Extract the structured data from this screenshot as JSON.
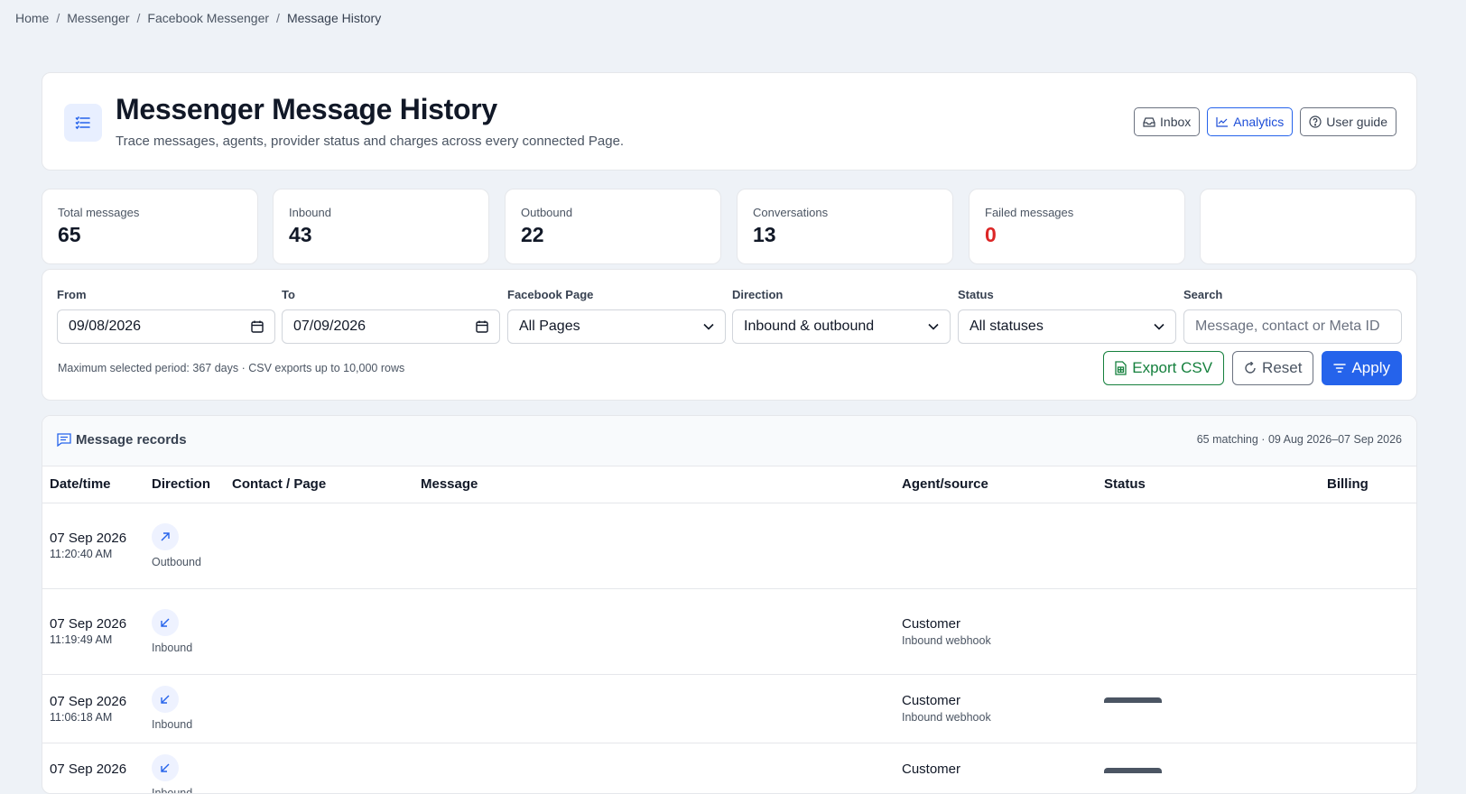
{
  "breadcrumb": [
    "Home",
    "Messenger",
    "Facebook Messenger",
    "Message History"
  ],
  "header": {
    "title": "Messenger Message History",
    "subtitle": "Trace messages, agents, provider status and charges across every connected Page.",
    "icon": "list-icon",
    "actions": {
      "inbox": "Inbox",
      "analytics": "Analytics",
      "guide": "User guide"
    }
  },
  "stats": [
    {
      "label": "Total messages",
      "value": "65"
    },
    {
      "label": "Inbound",
      "value": "43"
    },
    {
      "label": "Outbound",
      "value": "22"
    },
    {
      "label": "Conversations",
      "value": "13"
    },
    {
      "label": "Failed messages",
      "value": "0"
    }
  ],
  "filters": {
    "from": {
      "label": "From",
      "value": "09/08/2026"
    },
    "to": {
      "label": "To",
      "value": "07/09/2026"
    },
    "page": {
      "label": "Facebook Page",
      "value": "All Pages"
    },
    "direction": {
      "label": "Direction",
      "value": "Inbound & outbound"
    },
    "status": {
      "label": "Status",
      "value": "All statuses"
    },
    "search": {
      "label": "Search",
      "placeholder": "Message, contact or Meta ID"
    },
    "hint": "Maximum selected period: 367 days · CSV exports up to 10,000 rows",
    "export": "Export CSV",
    "reset": "Reset",
    "apply": "Apply"
  },
  "records": {
    "title": "Message records",
    "meta": "65 matching · 09 Aug 2026–07 Sep 2026",
    "columns": [
      "Date/time",
      "Direction",
      "Contact / Page",
      "Message",
      "Agent/source",
      "Status",
      "Billing"
    ],
    "rows": [
      {
        "date": "07 Sep 2026",
        "time": "11:20:40 AM",
        "direction": "Outbound",
        "agent": "",
        "source": ""
      },
      {
        "date": "07 Sep 2026",
        "time": "11:19:49 AM",
        "direction": "Inbound",
        "agent": "Customer",
        "source": "Inbound webhook"
      },
      {
        "date": "07 Sep 2026",
        "time": "11:06:18 AM",
        "direction": "Inbound",
        "agent": "Customer",
        "source": "Inbound webhook"
      },
      {
        "date": "07 Sep 2026",
        "time": "",
        "direction": "Inbound",
        "agent": "Customer",
        "source": ""
      }
    ]
  },
  "colors": {
    "accent": "#2563eb",
    "danger": "#dc2626",
    "success": "#15803d"
  }
}
